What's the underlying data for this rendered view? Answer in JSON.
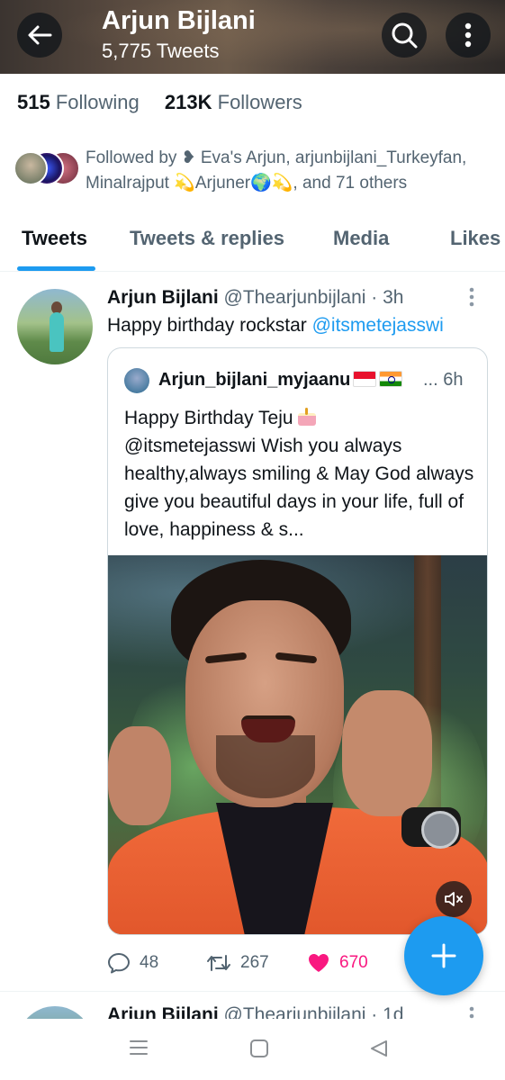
{
  "header": {
    "name": "Arjun Bijlani",
    "tweet_count": "5,775 Tweets",
    "back_icon": "arrow-left-icon",
    "search_icon": "search-icon",
    "more_icon": "vertical-dots-icon"
  },
  "stats": {
    "following_count": "515",
    "following_label": "Following",
    "followers_count": "213K",
    "followers_label": "Followers"
  },
  "followed_by": {
    "text": "Followed by ❥ Eva's Arjun, arjunbijlani_Turkeyfan, Minalrajput 💫Arjuner🌍💫, and 71 others"
  },
  "tabs": [
    {
      "label": "Tweets",
      "active": true
    },
    {
      "label": "Tweets & replies",
      "active": false
    },
    {
      "label": "Media",
      "active": false
    },
    {
      "label": "Likes",
      "active": false
    }
  ],
  "tweet": {
    "name": "Arjun Bijlani",
    "handle_time": "@Thearjunbijlani · 3h",
    "text": "Happy birthday rockstar ",
    "mention": "@itsmetejasswi",
    "quote": {
      "name": "Arjun_bijlani_myjaanu",
      "meta": "... 6h",
      "text_line1": "Happy Birthday Teju",
      "text_rest": "@itsmetejasswi Wish you always healthy,always smiling & May God always give you beautiful days in your life, full of love, happiness & s..."
    },
    "actions": {
      "replies": "48",
      "retweets": "267",
      "likes": "670"
    }
  },
  "next_tweet": {
    "name": "Arjun Bijlani",
    "handle_time": "@Thearjunbijlani · 1d"
  },
  "colors": {
    "accent": "#1d9bf0",
    "like": "#f91880",
    "secondary_text": "#536471"
  }
}
